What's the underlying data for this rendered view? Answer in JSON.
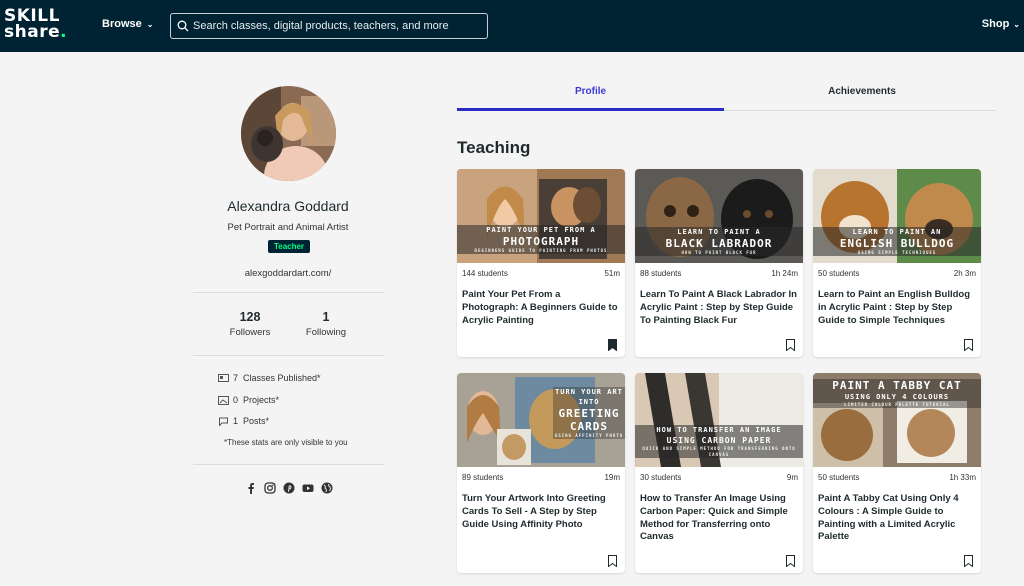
{
  "header": {
    "logo_line1": "SKILL",
    "logo_line2": "share",
    "logo_dot": ".",
    "browse_label": "Browse",
    "search_placeholder": "Search classes, digital products, teachers, and more",
    "shop_label": "Shop"
  },
  "profile": {
    "name": "Alexandra Goddard",
    "subtitle": "Pet Portrait and Animal Artist",
    "badge": "Teacher",
    "website": "alexgoddardart.com/",
    "followers_count": "128",
    "followers_label": "Followers",
    "following_count": "1",
    "following_label": "Following",
    "stats": [
      {
        "icon": "classes-icon",
        "count": "7",
        "label": "Classes Published*"
      },
      {
        "icon": "projects-icon",
        "count": "0",
        "label": "Projects*"
      },
      {
        "icon": "posts-icon",
        "count": "1",
        "label": "Posts*"
      }
    ],
    "stats_note": "*These stats are only visible to you",
    "socials": [
      "facebook-icon",
      "instagram-icon",
      "pinterest-icon",
      "youtube-icon",
      "globe-icon"
    ]
  },
  "tabs": [
    {
      "label": "Profile",
      "active": true
    },
    {
      "label": "Achievements",
      "active": false
    }
  ],
  "section_title": "Teaching",
  "courses": [
    {
      "banner_top": "PAINT YOUR PET FROM A",
      "banner_main": "PHOTOGRAPH",
      "banner_sub": "BEGINNERS GUIDE TO PAINTING FROM PHOTOS",
      "students": "144 students",
      "duration": "51m",
      "title": "Paint Your Pet From a Photograph: A Beginners Guide to Acrylic Painting",
      "saved": true
    },
    {
      "banner_top": "LEARN TO PAINT A",
      "banner_main": "BLACK LABRADOR",
      "banner_sub": "HOW TO PAINT BLACK FUR",
      "students": "88 students",
      "duration": "1h 24m",
      "title": "Learn To Paint A Black Labrador In Acrylic Paint : Step by Step Guide To Painting Black Fur",
      "saved": false
    },
    {
      "banner_top": "LEARN TO PAINT AN",
      "banner_main": "ENGLISH BULLDOG",
      "banner_sub": "USING SIMPLE TECHNIQUES",
      "students": "50 students",
      "duration": "2h 3m",
      "title": "Learn to Paint an English Bulldog in Acrylic Paint : Step by Step Guide to Simple Techniques",
      "saved": false
    },
    {
      "banner_top": "TURN YOUR ART INTO",
      "banner_main": "GREETING CARDS",
      "banner_sub": "USING AFFINITY PHOTO",
      "students": "89 students",
      "duration": "19m",
      "title": "Turn Your Artwork Into Greeting Cards To Sell - A Step by Step Guide Using Affinity Photo",
      "saved": false
    },
    {
      "banner_top": "HOW TO TRANSFER AN IMAGE",
      "banner_main": "USING CARBON PAPER",
      "banner_sub": "QUICK AND SIMPLE METHOD FOR TRANSFERRING ONTO CANVAS",
      "students": "30 students",
      "duration": "9m",
      "title": "How to Transfer An Image Using Carbon Paper: Quick and Simple Method for Transferring onto Canvas",
      "saved": false
    },
    {
      "banner_top": "PAINT A TABBY CAT",
      "banner_main": "USING ONLY 4 COLOURS",
      "banner_sub": "LIMITED COLOUR PALETTE TUTORIAL",
      "students": "50 students",
      "duration": "1h 33m",
      "title": "Paint A Tabby Cat Using Only 4 Colours : A Simple Guide to Painting with a Limited Acrylic Palette",
      "saved": false
    }
  ],
  "colors": {
    "header_bg": "#002333",
    "brand_green": "#00ff84",
    "tab_active": "#3b3bd6"
  }
}
